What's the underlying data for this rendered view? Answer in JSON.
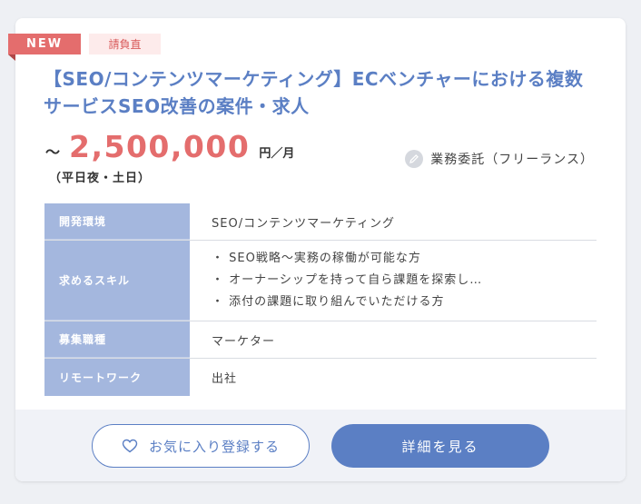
{
  "badges": {
    "new": "NEW",
    "direct": "請負直"
  },
  "job": {
    "title": "【SEO/コンテンツマーケティング】ECベンチャーにおける複数サービスSEO改善の案件・求人",
    "price_prefix": "～",
    "price_amount": "2,500,000",
    "price_unit": "円／月",
    "price_note": "（平日夜・土日）",
    "contract_type": "業務委託（フリーランス）"
  },
  "spec": {
    "env_label": "開発環境",
    "env_value": "SEO/コンテンツマーケティング",
    "skills_label": "求めるスキル",
    "skills": [
      "・ SEO戦略～実務の稼働が可能な方",
      "・ オーナーシップを持って自ら課題を探索し…",
      "・ 添付の課題に取り組んでいただける方"
    ],
    "role_label": "募集職種",
    "role_value": "マーケター",
    "remote_label": "リモートワーク",
    "remote_value": "出社"
  },
  "actions": {
    "favorite_label": "お気に入り登録する",
    "detail_label": "詳細を見る"
  },
  "icons": {
    "contract": "pencil-icon",
    "favorite": "heart-icon"
  },
  "colors": {
    "accent_blue": "#5b7fc4",
    "table_header": "#a4b7de",
    "price_red": "#e46d6d",
    "new_badge": "#e46d6d",
    "direct_badge_bg": "#fdebeb"
  }
}
